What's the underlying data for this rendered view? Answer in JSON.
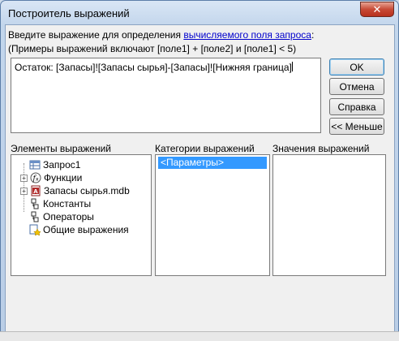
{
  "window": {
    "title": "Построитель выражений",
    "close_label": "✕"
  },
  "intro": {
    "line1_prefix": "Введите выражение для определения ",
    "line1_link": "вычисляемого поля запроса",
    "line1_suffix": ":",
    "line2": "(Примеры выражений включают [поле1] + [поле2] и [поле1] < 5)"
  },
  "expression": {
    "value": "Остаток: [Запасы]![Запасы сырья]-[Запасы]![Нижняя граница]"
  },
  "buttons": {
    "ok": "OK",
    "cancel": "Отмена",
    "help": "Справка",
    "less": "<< Меньше"
  },
  "panels": {
    "elements_label": "Элементы выражений",
    "categories_label": "Категории выражений",
    "values_label": "Значения выражений"
  },
  "tree": [
    {
      "label": "Запрос1",
      "icon": "query-icon",
      "expander": ""
    },
    {
      "label": "Функции",
      "icon": "functions-icon",
      "expander": "+"
    },
    {
      "label": "Запасы сырья.mdb",
      "icon": "database-icon",
      "expander": "+"
    },
    {
      "label": "Константы",
      "icon": "constants-icon",
      "expander": ""
    },
    {
      "label": "Операторы",
      "icon": "operators-icon",
      "expander": ""
    },
    {
      "label": "Общие выражения",
      "icon": "common-expressions-icon",
      "expander": ""
    }
  ],
  "categories": [
    "<Параметры>"
  ],
  "colors": {
    "selection": "#3399ff",
    "link": "#0000cc",
    "close": "#c74a36"
  }
}
